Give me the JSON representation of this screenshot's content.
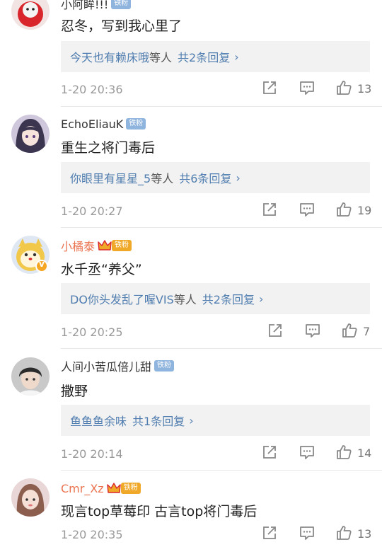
{
  "comments": [
    {
      "username": "小阿眸!!!",
      "fan_badge": "铁粉",
      "text": "忍冬，写到我心里了",
      "reply": {
        "users": "今天也有赖床哦",
        "mid": "等人",
        "count": "共2条回复",
        "chevron": "›"
      },
      "time": "1-20 20:36",
      "likes": "13"
    },
    {
      "username": "EchoEliauK",
      "fan_badge": "铁粉",
      "text": "重生之将门毒后",
      "reply": {
        "users": "你眼里有星星_5",
        "mid": "等人",
        "count": "共6条回复",
        "chevron": "›"
      },
      "time": "1-20 20:27",
      "likes": "19"
    },
    {
      "username": "小橘泰",
      "fan_badge": "铁粉",
      "text": "水千丞“养父”",
      "reply": {
        "users": "DO你头发乱了喔VIS",
        "mid": "等人",
        "count": "共2条回复",
        "chevron": "›"
      },
      "time": "1-20 20:25",
      "likes": "7"
    },
    {
      "username": "人间小苦瓜倍儿甜",
      "fan_badge": "铁粉",
      "text": "撒野",
      "reply": {
        "users": "鱼鱼鱼余味",
        "mid": "",
        "count": "共1条回复",
        "chevron": "›"
      },
      "time": "1-20 20:14",
      "likes": "14"
    },
    {
      "username": "Cmr_Xz",
      "fan_badge": "铁粉",
      "text": "现言top草莓印 古言top将门毒后",
      "time": "1-20 20:35",
      "likes": "13"
    }
  ],
  "colors": {
    "link_blue": "#507daf",
    "vip_orange": "#eb7350",
    "fan_badge_blue": "#8fb4dd",
    "fan_badge_gold": "#f0a828",
    "reply_bg": "#f2f2f2"
  }
}
